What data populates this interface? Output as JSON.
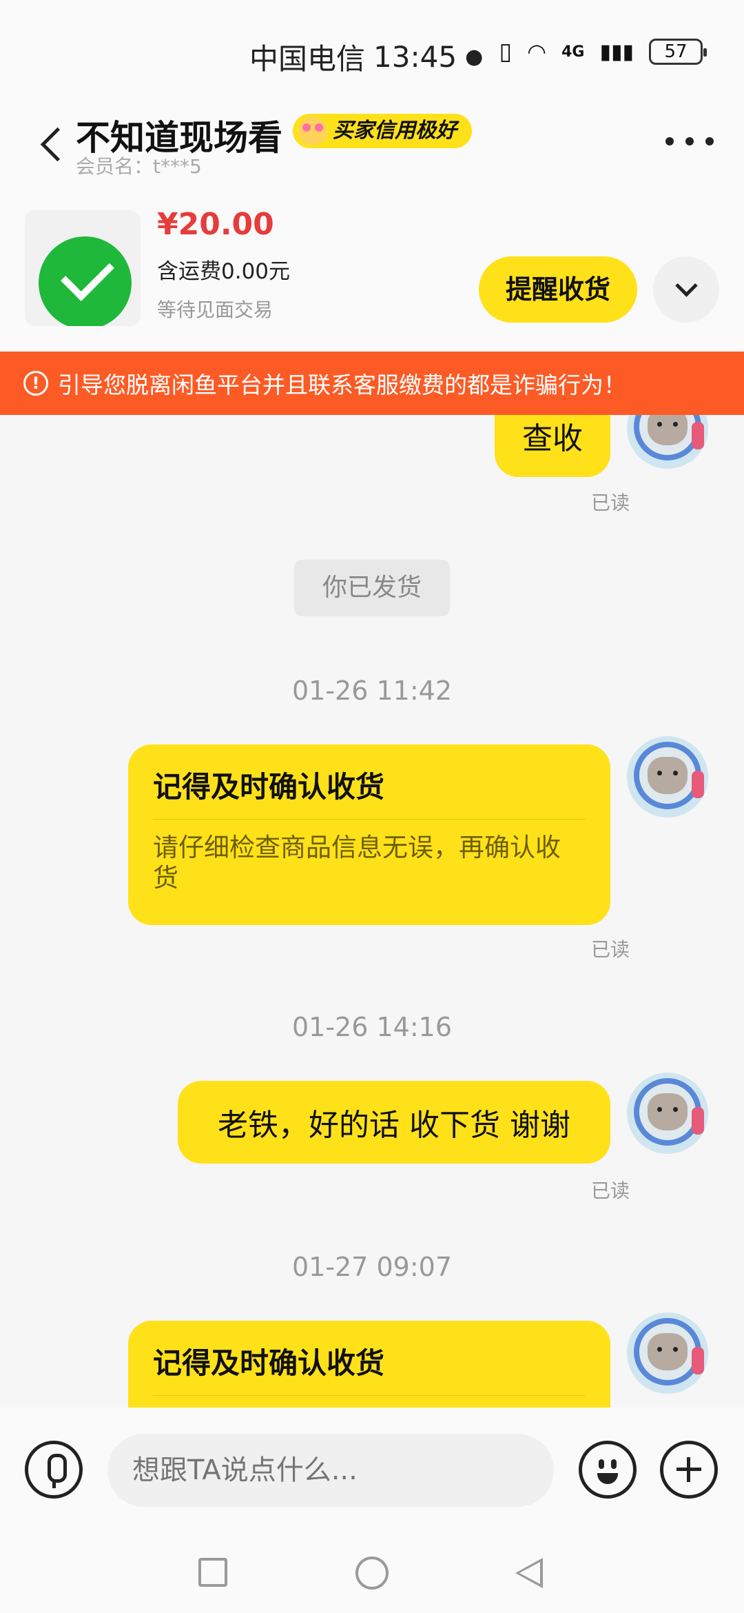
{
  "status_bar": {
    "carrier": "中国电信",
    "time": "13:45",
    "network": "4G",
    "battery": "57"
  },
  "header": {
    "title": "不知道现场看",
    "credit_badge": "买家信用极好",
    "member_name": "会员名：t***5"
  },
  "product": {
    "price": "¥20.00",
    "shipping": "含运费0.00元",
    "status": "等待见面交易",
    "remind_button": "提醒收货"
  },
  "warning": {
    "icon": "!",
    "text": "引导您脱离闲鱼平台并且联系客服缴费的都是诈骗行为！"
  },
  "messages": {
    "m1": {
      "text": "查收",
      "read": "已读"
    },
    "system": {
      "text": "你已发货"
    },
    "t1": "01-26 11:42",
    "card1": {
      "title": "记得及时确认收货",
      "body": "请仔细检查商品信息无误，再确认收货",
      "read": "已读"
    },
    "t2": "01-26 14:16",
    "m2": {
      "text": "老铁，好的话 收下货 谢谢",
      "read": "已读"
    },
    "t3": "01-27 09:07",
    "card2": {
      "title": "记得及时确认收货"
    }
  },
  "input": {
    "placeholder": "想跟TA说点什么..."
  },
  "colors": {
    "accent_yellow": "#ffe11a",
    "warning_orange": "#fc5b26",
    "price_red": "#e63c3c"
  }
}
